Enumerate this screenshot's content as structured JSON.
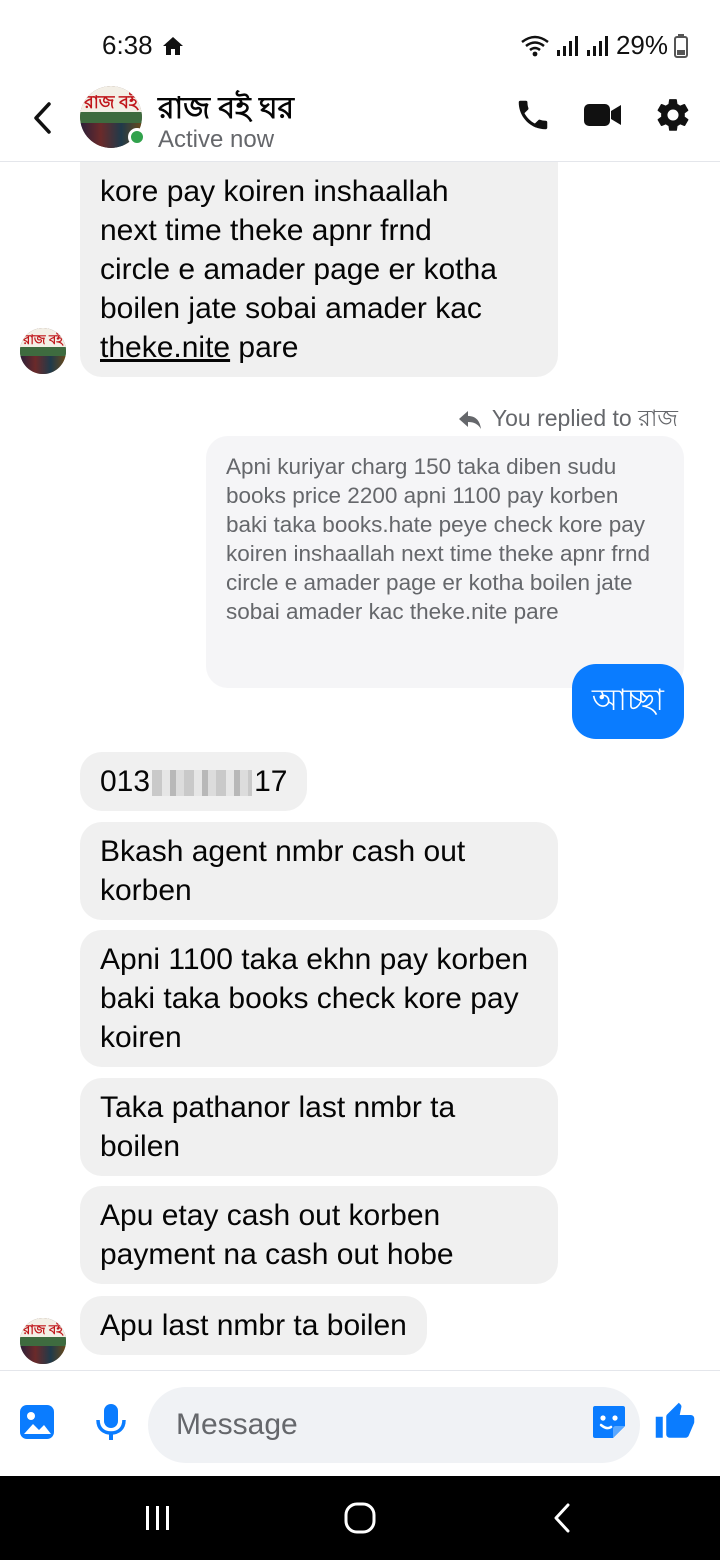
{
  "status": {
    "time": "6:38",
    "battery": "29%"
  },
  "header": {
    "name": "রাজ বই ঘর",
    "status": "Active now",
    "avatar_text": "রাজ বই"
  },
  "messages": {
    "m1_lines": [
      "kore pay koiren inshaallah",
      "next time theke apnr frnd",
      "circle e amader page er kotha",
      "boilen jate sobai amader kac"
    ],
    "m1_last_link": "theke.nite",
    "m1_last_rest": " pare",
    "replied_label": "You replied to রাজ",
    "quote": "Apni kuriyar charg 150 taka diben sudu books price 2200 apni 1100 pay korben baki taka books.hate peye check kore pay koiren inshaallah next time theke apnr frnd circle e amader page er kotha boilen jate sobai amader kac theke.nite pare",
    "reply_sent": "আচ্ছা",
    "phone_prefix": "013",
    "phone_suffix": "17",
    "m3": "Bkash agent nmbr cash out korben",
    "m4": "Apni 1100 taka ekhn pay korben baki taka books check kore pay koiren",
    "m5": "Taka pathanor last nmbr ta boilen",
    "m6": "Apu etay cash out korben payment na cash out hobe",
    "m7": "Apu last nmbr ta boilen"
  },
  "composer": {
    "placeholder": "Message"
  },
  "icons": {
    "back": "back-arrow-icon",
    "call": "phone-icon",
    "video": "video-icon",
    "info": "gear-icon",
    "gallery": "gallery-icon",
    "mic": "microphone-icon",
    "sticker": "sticker-icon",
    "like": "thumbs-up-icon"
  },
  "colors": {
    "accent": "#0a7cff",
    "incoming_bubble": "#f0f0f0",
    "online": "#31a24c"
  }
}
